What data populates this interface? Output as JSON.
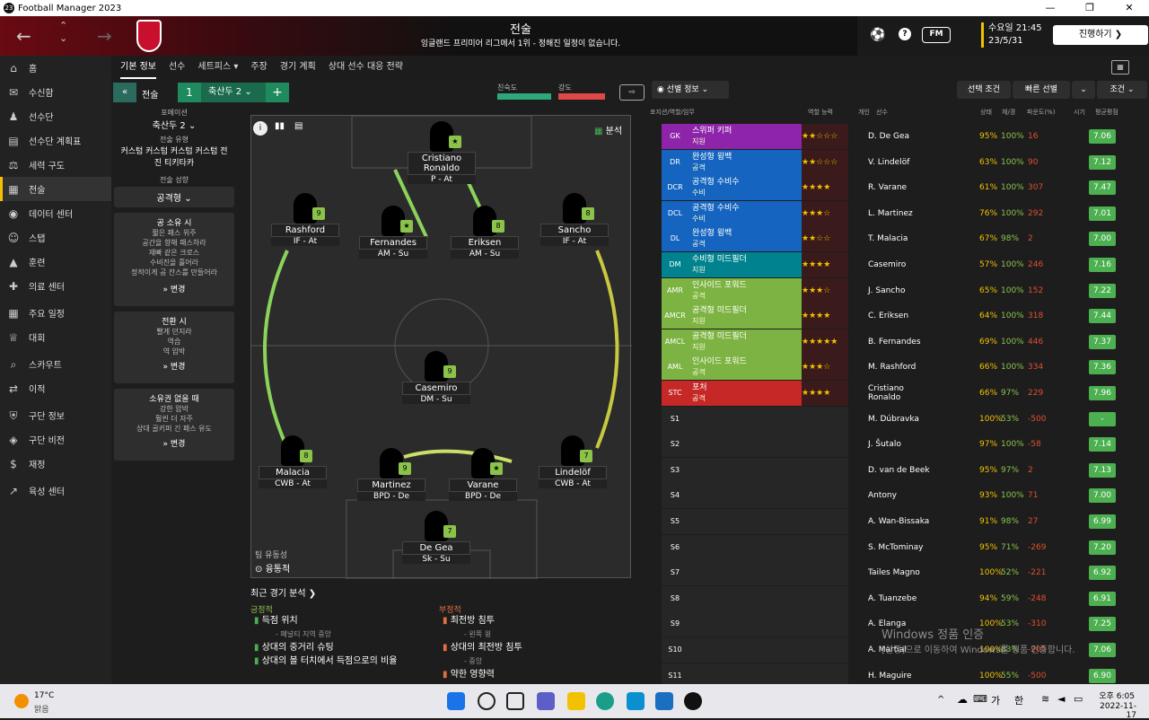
{
  "window": {
    "title": "Football Manager 2023"
  },
  "header": {
    "title": "전술",
    "subtitle": "잉글랜드 프리미어 리그에서 1위 - 정해진 일정이 없습니다.",
    "fm_label": "FM",
    "date_line1": "수요일 21:45",
    "date_line2": "23/5/31",
    "continue_label": "진행하기 ❯"
  },
  "sidebar": {
    "items": [
      {
        "label": "홈",
        "icon": "home-icon"
      },
      {
        "label": "수신함",
        "icon": "inbox-icon"
      },
      {
        "label": "선수단",
        "icon": "squad-icon"
      },
      {
        "label": "선수단 계획표",
        "icon": "squad-planner-icon"
      },
      {
        "label": "세력 구도",
        "icon": "dynamics-icon"
      },
      {
        "label": "전술",
        "icon": "tactics-icon"
      },
      {
        "label": "데이터 센터",
        "icon": "data-hub-icon"
      },
      {
        "label": "스탭",
        "icon": "staff-icon"
      },
      {
        "label": "훈련",
        "icon": "training-icon"
      },
      {
        "label": "의료 센터",
        "icon": "medical-icon"
      },
      {
        "label": "주요 일정",
        "icon": "schedule-icon"
      },
      {
        "label": "대회",
        "icon": "trophy-icon"
      },
      {
        "label": "스카우트",
        "icon": "scouting-icon"
      },
      {
        "label": "이적",
        "icon": "transfers-icon"
      },
      {
        "label": "구단 정보",
        "icon": "club-info-icon"
      },
      {
        "label": "구단 비전",
        "icon": "club-vision-icon"
      },
      {
        "label": "재정",
        "icon": "finance-icon"
      },
      {
        "label": "육성 센터",
        "icon": "development-icon"
      }
    ],
    "active_index": 5
  },
  "tabs": [
    "기본 정보",
    "선수",
    "세트피스 ▾",
    "주장",
    "경기 계획",
    "상대 선수 대응 전략"
  ],
  "subbar": {
    "tactic_label": "전술",
    "slot_number": "1",
    "slot_name": "축산두 2",
    "familiarity_label": "친숙도",
    "intensity_label": "강도",
    "selection_info": "선별 정보",
    "selection_conditions": "선택 조건",
    "quick_pick": "빠른 선별",
    "conditions": "조건"
  },
  "leftcol": {
    "formation_label": "포메이션",
    "formation": "축산두 2",
    "style_label": "전술 유형",
    "style": "커스텀 커스텀 커스텀 커스텀 전진 티키타카",
    "mentality_label": "전술 성향",
    "mentality": "공격형",
    "in_possession_title": "공 소유 시",
    "in_possession_lines": [
      "짧은 패스 위주",
      "공간을 향해 패스하라",
      "재빠 같은 크로스",
      "수비진을 흘어라",
      "정적이게 공 잔스를 만들어라"
    ],
    "in_transition_title": "전환 시",
    "in_transition_lines": [
      "빨게 던지라",
      "역습",
      "역 압박"
    ],
    "out_possession_title": "소유권 없을 때",
    "out_possession_lines": [
      "강한 압박",
      "훨씬 더 자주",
      "상대 골키퍼 긴 패스 유도"
    ],
    "change_label": "» 변경"
  },
  "pitch": {
    "analysis_label": "분석",
    "team_fluidity_label": "팀 유동성",
    "team_fluidity": "융통적",
    "players": [
      {
        "name": "Cristiano Ronaldo",
        "role": "P - At",
        "badge": "★"
      },
      {
        "name": "Rashford",
        "role": "IF - At",
        "badge": "9"
      },
      {
        "name": "Fernandes",
        "role": "AM - Su",
        "badge": "★"
      },
      {
        "name": "Eriksen",
        "role": "AM - Su",
        "badge": "8"
      },
      {
        "name": "Sancho",
        "role": "IF - At",
        "badge": "8"
      },
      {
        "name": "Casemiro",
        "role": "DM - Su",
        "badge": "9"
      },
      {
        "name": "Malacia",
        "role": "CWB - At",
        "badge": "8"
      },
      {
        "name": "Martinez",
        "role": "BPD - De",
        "badge": "9"
      },
      {
        "name": "Varane",
        "role": "BPD - De",
        "badge": "★"
      },
      {
        "name": "Lindelöf",
        "role": "CWB - At",
        "badge": "7"
      },
      {
        "name": "De Gea",
        "role": "Sk - Su",
        "badge": "7"
      }
    ]
  },
  "analysis": {
    "title": "최근 경기 분석 ❯",
    "positive_label": "긍정적",
    "negative_label": "부정적",
    "positives": [
      "득점 위치",
      "- 페널티 지역 중앙",
      "상대의 중거리 슈팅",
      "상대의 볼 터치에서 득점으로의 비율"
    ],
    "negatives": [
      "최전방 침투",
      "- 왼쪽 윙",
      "상대의 최전방 침투",
      "- 중앙",
      "약한 영향력"
    ]
  },
  "table": {
    "headers": [
      "포지션/역할/임무",
      "역할 능력",
      "개인",
      "선수",
      "상태",
      "체/경",
      "파운도(%)",
      "시기",
      "평균평점"
    ],
    "rows": [
      {
        "pos": "GK",
        "role": "스위퍼 키퍼",
        "duty": "지원",
        "color": "#8e24aa",
        "stars": "★★☆☆☆",
        "name": "D. De Gea",
        "cond": "95%",
        "sharp": "100%",
        "val": "16",
        "rating": "7.06"
      },
      {
        "pos": "DR",
        "role": "완성형 윙백",
        "duty": "공격",
        "color": "#1565c0",
        "stars": "★★☆☆☆",
        "name": "V. Lindelöf",
        "cond": "63%",
        "sharp": "100%",
        "val": "90",
        "rating": "7.12"
      },
      {
        "pos": "DCR",
        "role": "공격형 수비수",
        "duty": "수비",
        "color": "#1565c0",
        "stars": "★★★★",
        "name": "R. Varane",
        "cond": "61%",
        "sharp": "100%",
        "val": "307",
        "rating": "7.47"
      },
      {
        "pos": "DCL",
        "role": "공격형 수비수",
        "duty": "수비",
        "color": "#1565c0",
        "stars": "★★★☆",
        "name": "L. Martinez",
        "cond": "76%",
        "sharp": "100%",
        "val": "292",
        "rating": "7.01"
      },
      {
        "pos": "DL",
        "role": "완성형 윙백",
        "duty": "공격",
        "color": "#1565c0",
        "stars": "★★☆☆",
        "name": "T. Malacia",
        "cond": "67%",
        "sharp": "98%",
        "val": "2",
        "rating": "7.00"
      },
      {
        "pos": "DM",
        "role": "수비형 미드필더",
        "duty": "지원",
        "color": "#00838f",
        "stars": "★★★★",
        "name": "Casemiro",
        "cond": "57%",
        "sharp": "100%",
        "val": "246",
        "rating": "7.16"
      },
      {
        "pos": "AMR",
        "role": "인사이드 포워드",
        "duty": "공격",
        "color": "#7cb342",
        "stars": "★★★☆",
        "name": "J. Sancho",
        "cond": "65%",
        "sharp": "100%",
        "val": "152",
        "rating": "7.22"
      },
      {
        "pos": "AMCR",
        "role": "공격형 미드필더",
        "duty": "지원",
        "color": "#7cb342",
        "stars": "★★★★",
        "name": "C. Eriksen",
        "cond": "64%",
        "sharp": "100%",
        "val": "318",
        "rating": "7.44"
      },
      {
        "pos": "AMCL",
        "role": "공격형 미드필더",
        "duty": "지원",
        "color": "#7cb342",
        "stars": "★★★★★",
        "name": "B. Fernandes",
        "cond": "69%",
        "sharp": "100%",
        "val": "446",
        "rating": "7.37"
      },
      {
        "pos": "AML",
        "role": "인사이드 포워드",
        "duty": "공격",
        "color": "#7cb342",
        "stars": "★★★☆",
        "name": "M. Rashford",
        "cond": "66%",
        "sharp": "100%",
        "val": "334",
        "rating": "7.36"
      },
      {
        "pos": "STC",
        "role": "포처",
        "duty": "공격",
        "color": "#c62828",
        "stars": "★★★★",
        "name": "Cristiano Ronaldo",
        "cond": "66%",
        "sharp": "97%",
        "val": "229",
        "rating": "7.96"
      },
      {
        "pos": "S1",
        "role": "",
        "duty": "",
        "color": "",
        "stars": "",
        "name": "M. Dúbravka",
        "cond": "100%",
        "sharp": "53%",
        "val": "-500",
        "rating": "-"
      },
      {
        "pos": "S2",
        "role": "",
        "duty": "",
        "color": "",
        "stars": "",
        "name": "J. Šutalo",
        "cond": "97%",
        "sharp": "100%",
        "val": "-58",
        "rating": "7.14"
      },
      {
        "pos": "S3",
        "role": "",
        "duty": "",
        "color": "",
        "stars": "",
        "name": "D. van de Beek",
        "cond": "95%",
        "sharp": "97%",
        "val": "2",
        "rating": "7.13"
      },
      {
        "pos": "S4",
        "role": "",
        "duty": "",
        "color": "",
        "stars": "",
        "name": "Antony",
        "cond": "93%",
        "sharp": "100%",
        "val": "71",
        "rating": "7.00"
      },
      {
        "pos": "S5",
        "role": "",
        "duty": "",
        "color": "",
        "stars": "",
        "name": "A. Wan-Bissaka",
        "cond": "91%",
        "sharp": "98%",
        "val": "27",
        "rating": "6.99"
      },
      {
        "pos": "S6",
        "role": "",
        "duty": "",
        "color": "",
        "stars": "",
        "name": "S. McTominay",
        "cond": "95%",
        "sharp": "71%",
        "val": "-269",
        "rating": "7.20"
      },
      {
        "pos": "S7",
        "role": "",
        "duty": "",
        "color": "",
        "stars": "",
        "name": "Tailes Magno",
        "cond": "100%",
        "sharp": "52%",
        "val": "-221",
        "rating": "6.92"
      },
      {
        "pos": "S8",
        "role": "",
        "duty": "",
        "color": "",
        "stars": "",
        "name": "A. Tuanzebe",
        "cond": "94%",
        "sharp": "59%",
        "val": "-248",
        "rating": "6.91"
      },
      {
        "pos": "S9",
        "role": "",
        "duty": "",
        "color": "",
        "stars": "",
        "name": "A. Elanga",
        "cond": "100%",
        "sharp": "53%",
        "val": "-310",
        "rating": "7.25"
      },
      {
        "pos": "S10",
        "role": "",
        "duty": "",
        "color": "",
        "stars": "",
        "name": "A. Martial",
        "cond": "100%",
        "sharp": "83%",
        "val": "-205",
        "rating": "7.06"
      },
      {
        "pos": "S11",
        "role": "",
        "duty": "",
        "color": "",
        "stars": "",
        "name": "H. Maguire",
        "cond": "100%",
        "sharp": "55%",
        "val": "-500",
        "rating": "6.90"
      }
    ]
  },
  "watermark": {
    "line1": "Windows 정품 인증",
    "line2": "[설정]으로 이동하여 Windows를 정품 인증합니다."
  },
  "taskbar": {
    "weather_temp": "17°C",
    "weather_desc": "맑음",
    "time": "오후 6:05",
    "date": "2022-11-17",
    "ime_lang": "가",
    "ime_mode": "한"
  }
}
